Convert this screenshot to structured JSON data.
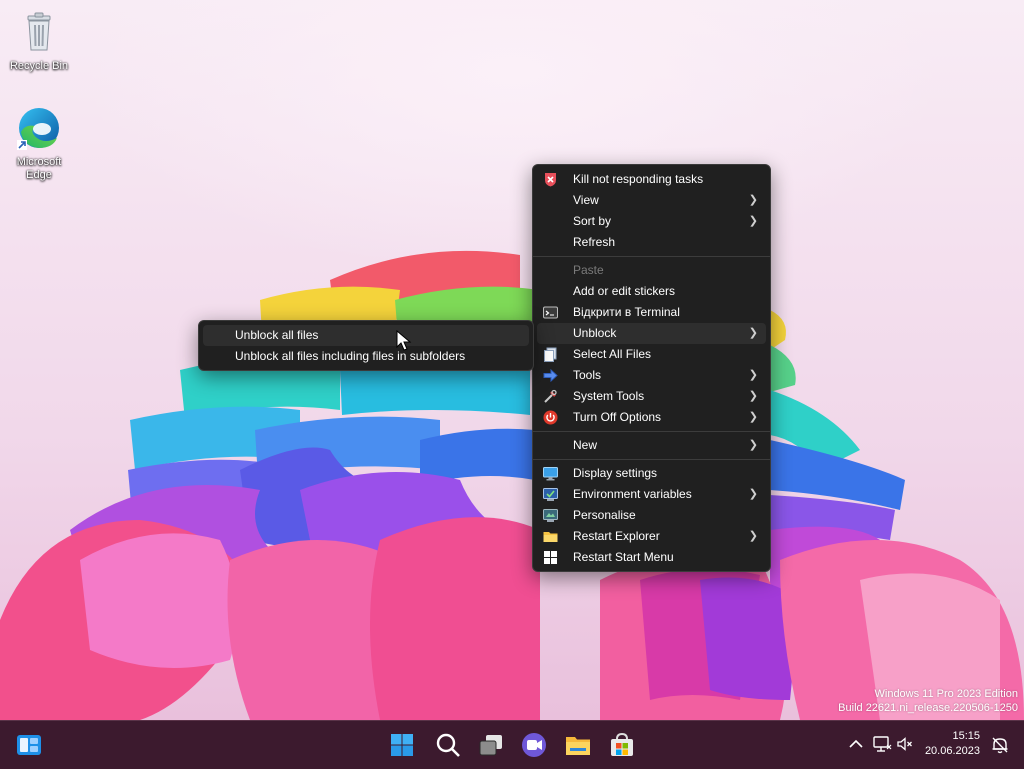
{
  "desktop": {
    "icons": [
      {
        "label": "Recycle Bin"
      },
      {
        "label": "Microsoft Edge"
      }
    ],
    "watermark": {
      "line1": "Windows 11 Pro 2023 Edition",
      "line2": "Build 22621.ni_release.220506-1250"
    }
  },
  "context_menu": {
    "items": [
      {
        "label": "Kill not responding tasks",
        "icon": "kill-tasks-icon"
      },
      {
        "label": "View",
        "has_submenu": true
      },
      {
        "label": "Sort by",
        "has_submenu": true
      },
      {
        "label": "Refresh"
      },
      {
        "label": "Paste",
        "disabled": true
      },
      {
        "label": "Add or edit stickers"
      },
      {
        "label": "Відкрити в Terminal",
        "icon": "terminal-icon"
      },
      {
        "label": "Unblock",
        "has_submenu": true,
        "highlighted": true
      },
      {
        "label": "Select All Files",
        "icon": "select-all-icon"
      },
      {
        "label": "Tools",
        "icon": "tools-arrow-icon",
        "has_submenu": true
      },
      {
        "label": "System Tools",
        "icon": "system-tools-icon",
        "has_submenu": true
      },
      {
        "label": "Turn Off Options",
        "icon": "power-icon",
        "has_submenu": true
      },
      {
        "label": "New",
        "has_submenu": true
      },
      {
        "label": "Display settings",
        "icon": "display-icon"
      },
      {
        "label": "Environment variables",
        "icon": "env-vars-icon",
        "has_submenu": true
      },
      {
        "label": "Personalise",
        "icon": "personalise-icon"
      },
      {
        "label": "Restart Explorer",
        "icon": "folder-icon",
        "has_submenu": true
      },
      {
        "label": "Restart Start Menu",
        "icon": "windows-logo-icon"
      }
    ],
    "submenu_unblock": [
      {
        "label": "Unblock all files",
        "highlighted": true
      },
      {
        "label": "Unblock all files including files in subfolders"
      }
    ]
  },
  "taskbar": {
    "pinned": [
      "widgets-icon",
      "start-icon",
      "search-icon",
      "task-view-icon",
      "chat-icon",
      "file-explorer-icon",
      "store-icon"
    ],
    "tray": {
      "time": "15:15",
      "date": "20.06.2023"
    }
  },
  "colors": {
    "menu_bg": "#202020",
    "taskbar_bg": "#3c1a2e",
    "accent": "#0078d4"
  }
}
